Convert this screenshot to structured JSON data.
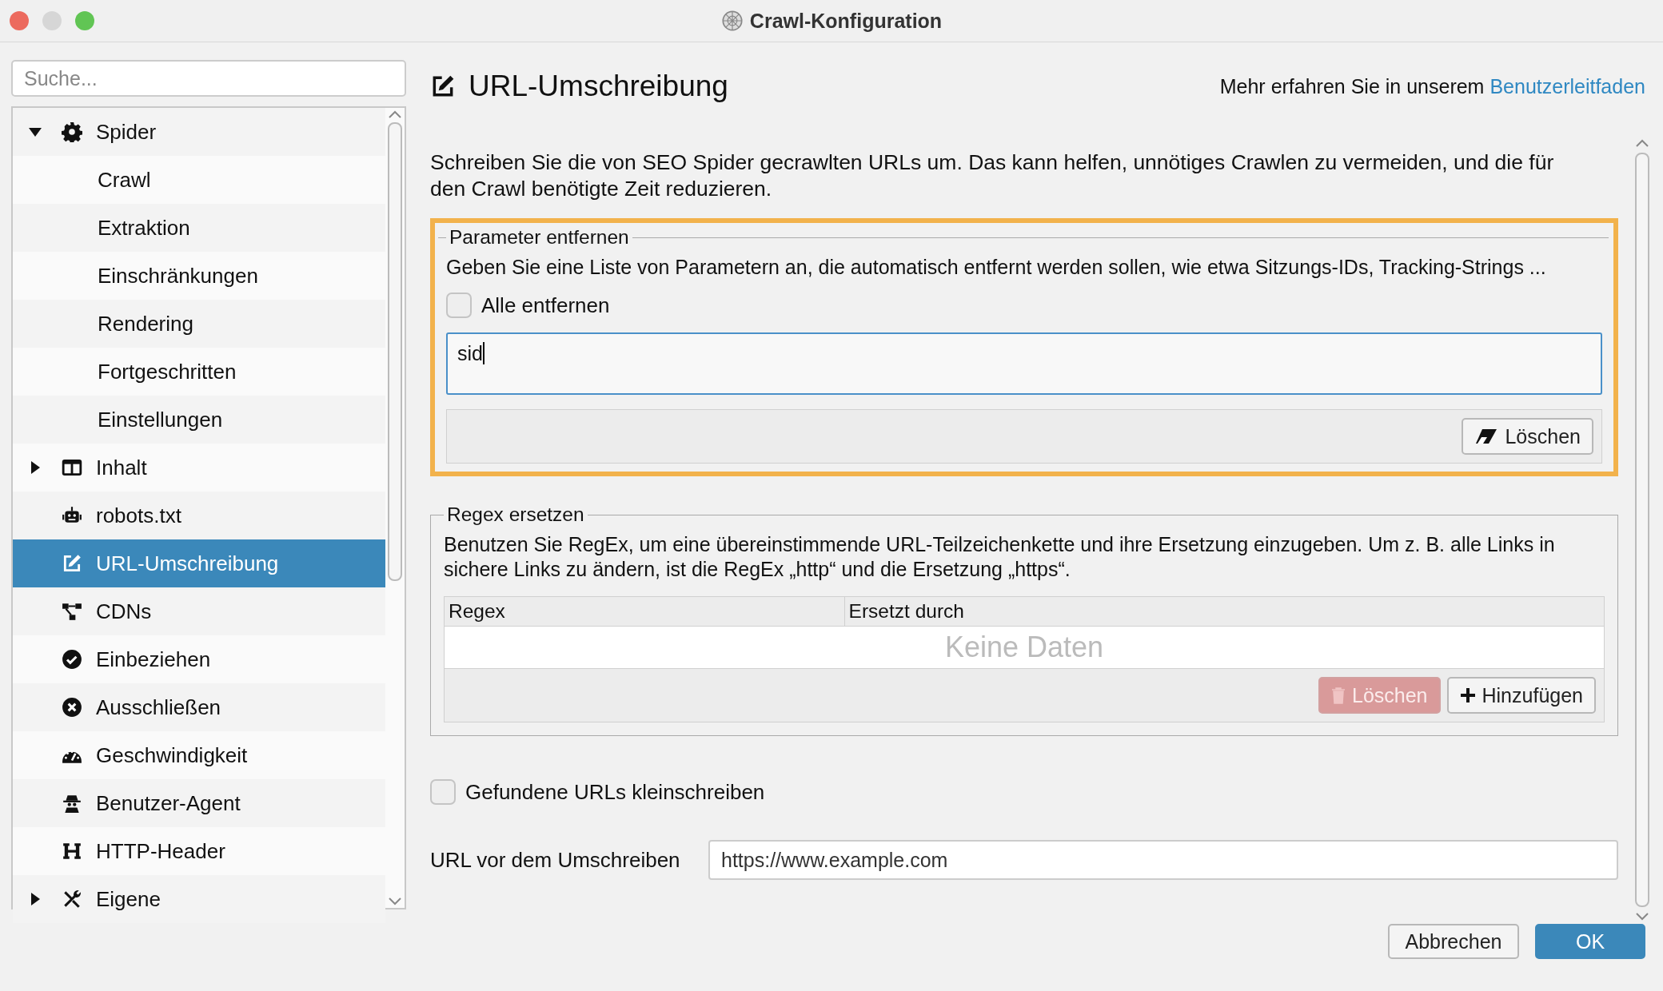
{
  "window": {
    "title": "Crawl-Konfiguration"
  },
  "sidebar": {
    "search": {
      "placeholder": "Suche..."
    },
    "items": [
      {
        "label": "Spider",
        "expanded": true,
        "selected": false,
        "children": [
          {
            "label": "Crawl",
            "selected": false
          },
          {
            "label": "Extraktion",
            "selected": false
          },
          {
            "label": "Einschränkungen",
            "selected": false
          },
          {
            "label": "Rendering",
            "selected": false
          },
          {
            "label": "Fortgeschritten",
            "selected": false
          },
          {
            "label": "Einstellungen",
            "selected": false
          }
        ]
      },
      {
        "label": "Inhalt",
        "expanded": false,
        "selected": false
      },
      {
        "label": "robots.txt",
        "selected": false
      },
      {
        "label": "URL-Umschreibung",
        "selected": true
      },
      {
        "label": "CDNs",
        "selected": false
      },
      {
        "label": "Einbeziehen",
        "selected": false
      },
      {
        "label": "Ausschließen",
        "selected": false
      },
      {
        "label": "Geschwindigkeit",
        "selected": false
      },
      {
        "label": "Benutzer-Agent",
        "selected": false
      },
      {
        "label": "HTTP-Header",
        "selected": false
      },
      {
        "label": "Eigene",
        "expanded": false,
        "selected": false
      }
    ]
  },
  "page": {
    "title": "URL-Umschreibung",
    "help_text": "Mehr erfahren Sie in unserem",
    "help_link": "Benutzerleitfaden",
    "description": "Schreiben Sie die von SEO Spider gecrawlten URLs um. Das kann helfen, unnötiges Crawlen zu vermeiden, und die für den Crawl benötigte Zeit reduzieren."
  },
  "remove_parameters": {
    "title": "Parameter entfernen",
    "highlighted": true,
    "description": "Geben Sie eine Liste von Parametern an, die automatisch entfernt werden sollen, wie etwa Sitzungs-IDs, Tracking-Strings ...",
    "remove_all": {
      "label": "Alle entfernen",
      "checked": false
    },
    "parameters": {
      "value": "sid"
    },
    "clear_button": "Löschen"
  },
  "regex_replace": {
    "title": "Regex ersetzen",
    "description": "Benutzen Sie RegEx, um eine übereinstimmende URL-Teilzeichenkette und ihre Ersetzung einzugeben. Um z. B. alle Links in sichere Links zu ändern, ist die RegEx „http“ und die Ersetzung „https“.",
    "table": {
      "columns": [
        "Regex",
        "Ersetzt durch"
      ],
      "empty_text": "Keine Daten"
    },
    "buttons": [
      {
        "label": "Löschen",
        "kind": "delete",
        "disabled": true
      },
      {
        "label": "Hinzufügen",
        "kind": "add",
        "disabled": false
      }
    ]
  },
  "lowercase": {
    "label": "Gefundene URLs kleinschreiben",
    "checked": false
  },
  "test_url": {
    "label": "URL vor dem Umschreiben",
    "value": "https://www.example.com"
  },
  "buttons": [
    {
      "label": "Abbrechen",
      "primary": false
    },
    {
      "label": "OK",
      "primary": true
    }
  ]
}
